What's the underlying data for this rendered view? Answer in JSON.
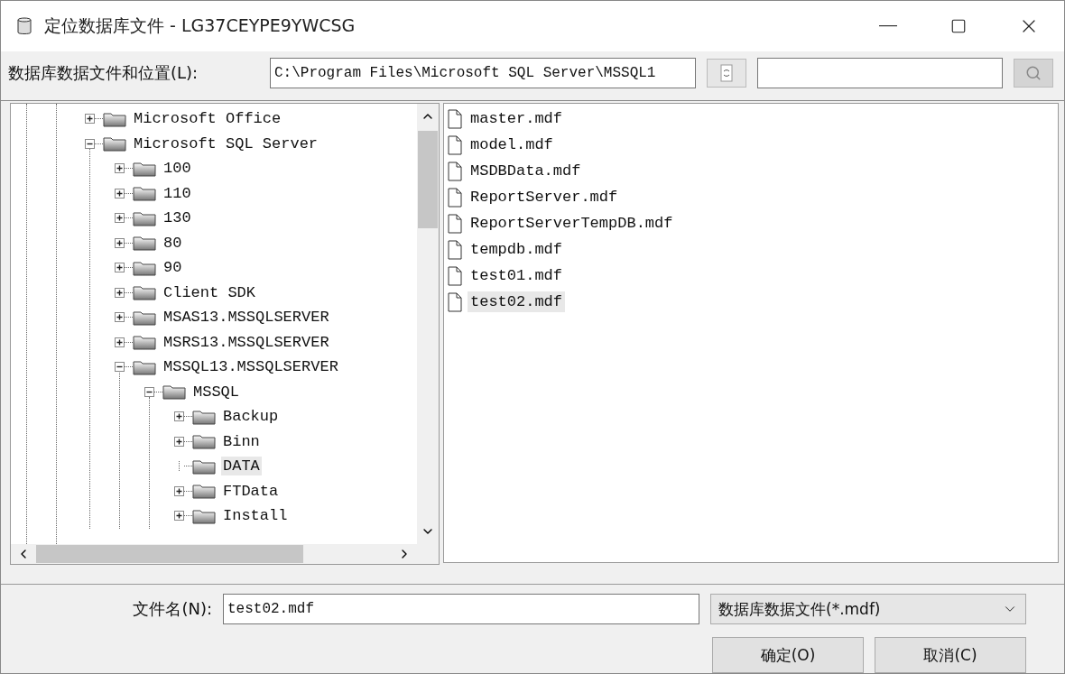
{
  "window": {
    "title": "定位数据库文件 - LG37CEYPE9YWCSG"
  },
  "location": {
    "label": "数据库数据文件和位置(L):",
    "path": "C:\\Program Files\\Microsoft SQL Server\\MSSQL1"
  },
  "tree": [
    {
      "label": "Microsoft Office",
      "kind": "expandable",
      "expanded": false,
      "selected": false
    },
    {
      "label": "Microsoft SQL Server",
      "kind": "expandable",
      "expanded": true,
      "selected": false,
      "children": [
        {
          "label": "100",
          "kind": "expandable",
          "expanded": false,
          "selected": false
        },
        {
          "label": "110",
          "kind": "expandable",
          "expanded": false,
          "selected": false
        },
        {
          "label": "130",
          "kind": "expandable",
          "expanded": false,
          "selected": false
        },
        {
          "label": "80",
          "kind": "expandable",
          "expanded": false,
          "selected": false
        },
        {
          "label": "90",
          "kind": "expandable",
          "expanded": false,
          "selected": false
        },
        {
          "label": "Client SDK",
          "kind": "expandable",
          "expanded": false,
          "selected": false
        },
        {
          "label": "MSAS13.MSSQLSERVER",
          "kind": "expandable",
          "expanded": false,
          "selected": false
        },
        {
          "label": "MSRS13.MSSQLSERVER",
          "kind": "expandable",
          "expanded": false,
          "selected": false
        },
        {
          "label": "MSSQL13.MSSQLSERVER",
          "kind": "expandable",
          "expanded": true,
          "selected": false,
          "children": [
            {
              "label": "MSSQL",
              "kind": "expandable",
              "expanded": true,
              "selected": false,
              "children": [
                {
                  "label": "Backup",
                  "kind": "expandable",
                  "expanded": false,
                  "selected": false
                },
                {
                  "label": "Binn",
                  "kind": "expandable",
                  "expanded": false,
                  "selected": false
                },
                {
                  "label": "DATA",
                  "kind": "leaf",
                  "selected": true
                },
                {
                  "label": "FTData",
                  "kind": "expandable",
                  "expanded": false,
                  "selected": false
                },
                {
                  "label": "Install",
                  "kind": "expandable",
                  "expanded": false,
                  "selected": false
                }
              ]
            }
          ]
        }
      ]
    }
  ],
  "files": [
    {
      "name": "master.mdf",
      "selected": false
    },
    {
      "name": "model.mdf",
      "selected": false
    },
    {
      "name": "MSDBData.mdf",
      "selected": false
    },
    {
      "name": "ReportServer.mdf",
      "selected": false
    },
    {
      "name": "ReportServerTempDB.mdf",
      "selected": false
    },
    {
      "name": "tempdb.mdf",
      "selected": false
    },
    {
      "name": "test01.mdf",
      "selected": false
    },
    {
      "name": "test02.mdf",
      "selected": true
    }
  ],
  "file_name": {
    "label": "文件名(N):",
    "value": "test02.mdf"
  },
  "file_type": {
    "value": "数据库数据文件(*.mdf)"
  },
  "buttons": [
    "确定(O)",
    "取消(C)"
  ]
}
